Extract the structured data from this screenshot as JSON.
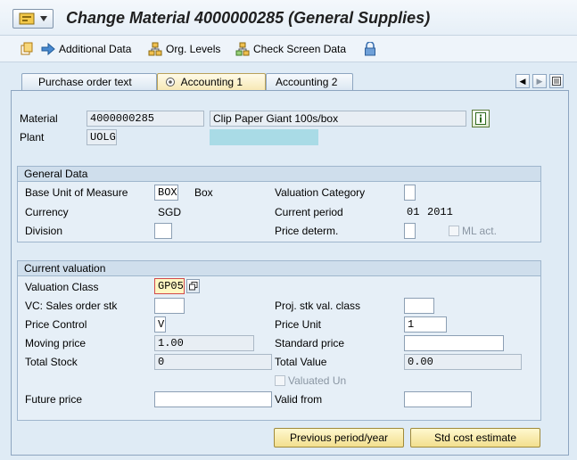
{
  "title": "Change Material 4000000285 (General Supplies)",
  "toolbar": {
    "additional_data": "Additional Data",
    "org_levels": "Org. Levels",
    "check_screen_data": "Check Screen Data"
  },
  "tabs": [
    {
      "label": "Purchase order text"
    },
    {
      "label": "Accounting 1"
    },
    {
      "label": "Accounting 2"
    }
  ],
  "header": {
    "material_label": "Material",
    "material_value": "4000000285",
    "material_desc": "Clip Paper Giant 100s/box",
    "plant_label": "Plant",
    "plant_value": "UOLG"
  },
  "general": {
    "title": "General Data",
    "base_uom_label": "Base Unit of Measure",
    "base_uom_value": "BOX",
    "base_uom_text": "Box",
    "valuation_category_label": "Valuation Category",
    "currency_label": "Currency",
    "currency_value": "SGD",
    "current_period_label": "Current period",
    "current_period_month": "01",
    "current_period_year": "2011",
    "division_label": "Division",
    "price_determ_label": "Price determ.",
    "ml_act_label": "ML act."
  },
  "valuation": {
    "title": "Current valuation",
    "valuation_class_label": "Valuation Class",
    "valuation_class_value": "GP05",
    "vc_sales_label": "VC: Sales order stk",
    "proj_stk_label": "Proj. stk val. class",
    "price_control_label": "Price Control",
    "price_control_value": "V",
    "price_unit_label": "Price Unit",
    "price_unit_value": "1",
    "moving_price_label": "Moving price",
    "moving_price_value": "1.00",
    "standard_price_label": "Standard price",
    "total_stock_label": "Total Stock",
    "total_stock_value": "0",
    "total_value_label": "Total Value",
    "total_value_value": "0.00",
    "valuated_un_label": "Valuated Un",
    "future_price_label": "Future price",
    "valid_from_label": "Valid from"
  },
  "buttons": {
    "previous_period": "Previous period/year",
    "std_cost_estimate": "Std cost estimate"
  },
  "colors": {
    "background": "#dfebf5",
    "accent_highlight": "#a9dbe6",
    "active_field": "#fff7c2"
  }
}
